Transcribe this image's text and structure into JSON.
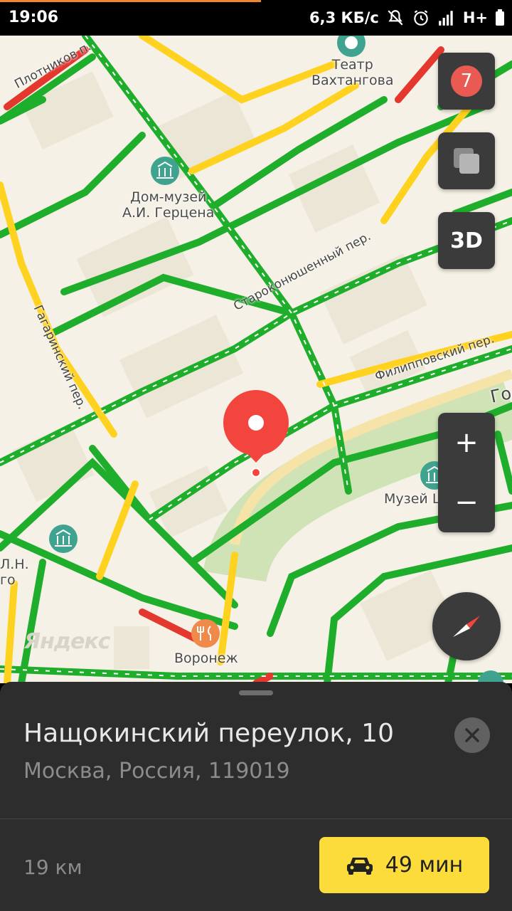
{
  "status_bar": {
    "time": "19:06",
    "network_speed": "6,3 КБ/с",
    "network_type": "H+",
    "icons": [
      "mute-icon",
      "alarm-icon",
      "signal-icon",
      "battery-icon"
    ]
  },
  "map": {
    "poi": {
      "theatre": "Театр\nВахтангова",
      "herzen_museum": "Дом-музей\nА.И. Герцена",
      "chess_museum": "Музей Шахмат",
      "restaurant": "Воронеж",
      "partial_left": "Л.Н.\nго"
    },
    "streets": {
      "plotnikov": "Плотников п.",
      "starokonyushenny": "Староконюшенный пер.",
      "gagarinsky": "Гагаринский пер.",
      "filippovsky": "Филипповский пер.",
      "partial_right": "Го"
    },
    "watermark": "Яндекс",
    "traffic_colors": {
      "free": "#1fae2b",
      "slow": "#ffd21f",
      "jam": "#e4382f"
    }
  },
  "controls": {
    "traffic_level": "7",
    "mode_3d": "3D",
    "zoom_in": "+",
    "zoom_out": "−"
  },
  "sheet": {
    "title": "Нащокинский переулок, 10",
    "subtitle": "Москва, Россия, 119019",
    "distance": "19 км",
    "route_time": "49 мин"
  },
  "colors": {
    "accent": "#fbdc3b",
    "pin": "#f1453d",
    "sheet_bg": "#2d2d2d"
  }
}
